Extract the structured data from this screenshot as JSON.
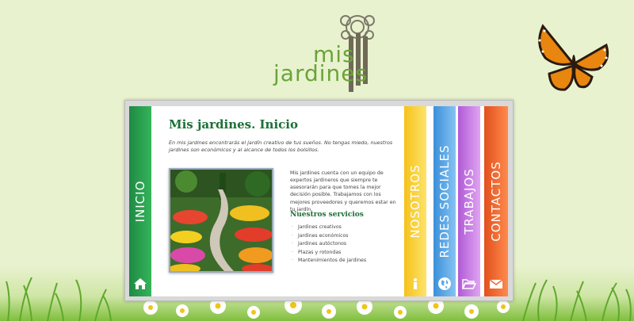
{
  "brand": {
    "line1": "mis",
    "line2": "jardines"
  },
  "tabs": {
    "inicio": "INICIO",
    "nosotros": "NOSOTROS",
    "redes": "REDES SOCIALES",
    "trabajos": "TRABAJOS",
    "contactos": "CONTACTOS"
  },
  "icons": {
    "inicio": "home-icon",
    "nosotros": "info-icon",
    "redes": "globe-icon",
    "trabajos": "folder-open-icon",
    "contactos": "envelope-icon"
  },
  "colors": {
    "inicio": "#2a9a4d",
    "nosotros": "#f8cf36",
    "redes": "#5ea9e8",
    "trabajos": "#c87ee6",
    "contactos": "#f06a30"
  },
  "main": {
    "title": "Mis jardines. Inicio",
    "intro": "En mis jardines encontrarás el jardín creativo de tus sueños. No tengas miedo, nuestros jardines son económicos y al alcance de todos los bolsillos.",
    "description": "Mis jardines cuenta con un equipo de expertos jardineros que siempre te asesorarán para que tomes la mejor decisión posible. Trabajamos con los mejores proveedores y queremos estar en tu jardín.",
    "services_title": "Nuestros servicios",
    "services": [
      "Jardines creativos",
      "Jardines económicos",
      "Jardines autóctonos",
      "Plazas y rotondas",
      "Mantenimientos de jardines"
    ]
  }
}
